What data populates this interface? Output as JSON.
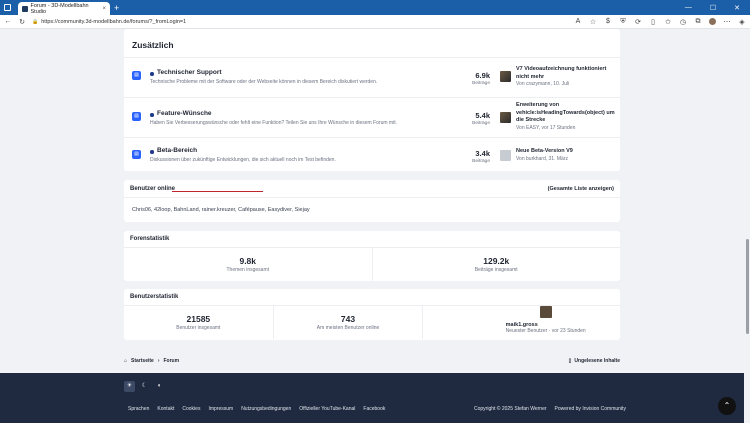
{
  "browser": {
    "tab_title": "Forum - 3D-Modellbahn Studio",
    "url": "https://community.3d-modellbahn.de/forums/?_fromLogin=1"
  },
  "extra_section": {
    "title": "Zusätzlich",
    "forums": [
      {
        "name": "Technischer Support",
        "description": "Technische Probleme mit der Software oder der Webseite können in diesem Bereich diskutiert werden.",
        "count": "6.9k",
        "count_label": "Beiträge",
        "last_title": "V7 Videoaufzeichnung funktioniert nicht mehr",
        "last_meta": "Von crazymann, 10. Juli"
      },
      {
        "name": "Feature-Wünsche",
        "description": "Haben Sie Verbesserungswünsche oder fehlt eine Funktion? Teilen Sie uns Ihre Wünsche in diesem Forum mit.",
        "count": "5.4k",
        "count_label": "Beiträge",
        "last_title": "Erweiterung von vehicle:isHeadingTowards(object) um die Strecke",
        "last_meta": "Von EASY, vor 17 Stunden"
      },
      {
        "name": "Beta-Bereich",
        "description": "Diskussionen über zukünftige Entwicklungen, die sich aktuell noch im Test befinden.",
        "count": "3.4k",
        "count_label": "Beiträge",
        "last_title": "Neue Beta-Version V9",
        "last_meta": "Von burkhard, 31. März"
      }
    ]
  },
  "online": {
    "title": "Benutzer online",
    "view_all": "(Gesamte Liste anzeigen)",
    "users": "Chris06, 42loop, BahnLand, rainer.kreuzer, Cafépause, Easydiver, Siejay"
  },
  "forum_stats": {
    "title": "Forenstatistik",
    "topics": "9.8k",
    "topics_label": "Themen insgesamt",
    "posts": "129.2k",
    "posts_label": "Beiträge insgesamt"
  },
  "user_stats": {
    "title": "Benutzerstatistik",
    "total": "21585",
    "total_label": "Benutzer insgesamt",
    "max_online": "743",
    "max_online_label": "Am meisten Benutzer online",
    "newest_name": "maik1.gross",
    "newest_meta": "Neuester Benutzer · vor 23 Stunden"
  },
  "breadcrumb": {
    "home": "Startseite",
    "current": "Forum",
    "unread": "Ungelesene Inhalte"
  },
  "footer": {
    "links": [
      "Sprachen",
      "Kontakt",
      "Cookies",
      "Impressum",
      "Nutzungsbedingungen",
      "Offizieller YouTube-Kanal",
      "Facebook"
    ],
    "copyright": "Copyright © 2025 Stefan Werner",
    "powered": "Powered by Invision Community"
  },
  "colors": {
    "accent": "#2962ff",
    "footer_bg": "#1f2a40",
    "underline": "#c0262d"
  }
}
